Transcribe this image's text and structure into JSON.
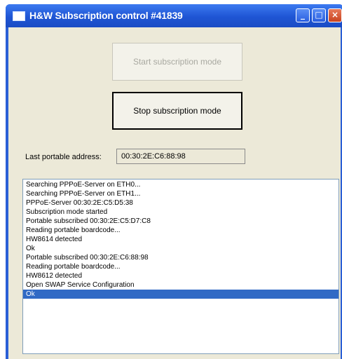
{
  "window": {
    "title": "H&W Subscription control #41839",
    "controls": {
      "minimize": "_",
      "maximize": "□",
      "close": "×"
    }
  },
  "buttons": {
    "start_label": "Start subscription mode",
    "stop_label": "Stop subscription mode"
  },
  "address": {
    "label": "Last portable address:",
    "value": "00:30:2E:C6:88:98"
  },
  "log": {
    "selected_index": 12,
    "lines": [
      "Searching PPPoE-Server on ETH0...",
      "Searching PPPoE-Server on ETH1...",
      "PPPoE-Server 00:30:2E:C5:D5:38",
      "Subscription mode started",
      "Portable subscribed 00:30:2E:C5:D7:C8",
      "Reading portable boardcode...",
      "HW8614 detected",
      "Ok",
      "Portable subscribed 00:30:2E:C6:88:98",
      "Reading portable boardcode...",
      "HW8612 detected",
      "Open SWAP Service Configuration",
      "Ok"
    ]
  },
  "colors": {
    "titlebar": "#1f55d4",
    "selection": "#316ac5",
    "dialog_bg": "#ece9d8"
  }
}
